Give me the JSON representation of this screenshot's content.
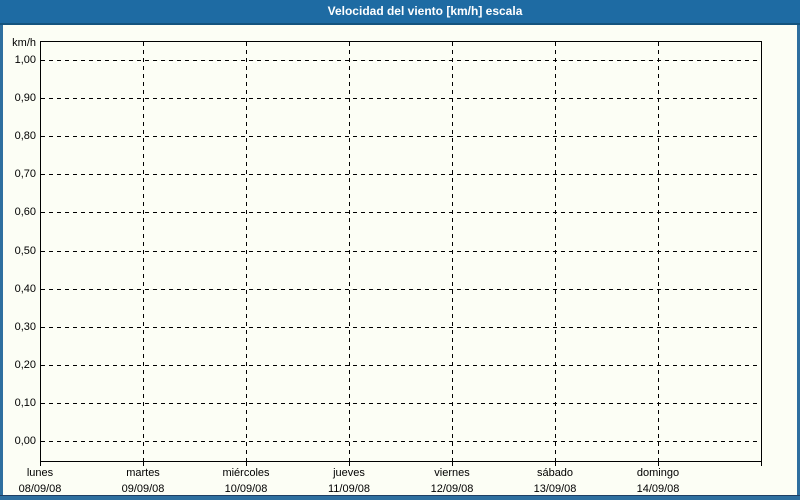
{
  "window": {
    "title": "Velocidad del viento [km/h] escala"
  },
  "y_axis": {
    "unit": "km/h",
    "ticks": [
      "1,00",
      "0,90",
      "0,80",
      "0,70",
      "0,60",
      "0,50",
      "0,40",
      "0,30",
      "0,20",
      "0,10",
      "0,00"
    ]
  },
  "x_axis": {
    "days": [
      {
        "day": "lunes",
        "date": "08/09/08"
      },
      {
        "day": "martes",
        "date": "09/09/08"
      },
      {
        "day": "miércoles",
        "date": "10/09/08"
      },
      {
        "day": "jueves",
        "date": "11/09/08"
      },
      {
        "day": "viernes",
        "date": "12/09/08"
      },
      {
        "day": "sábado",
        "date": "13/09/08"
      },
      {
        "day": "domingo",
        "date": "14/09/08"
      }
    ]
  },
  "chart_data": {
    "type": "line",
    "title": "Velocidad del viento [km/h] escala",
    "ylabel": "km/h",
    "ylim": [
      0.0,
      1.0
    ],
    "y_tick_step": 0.1,
    "y_tick_labels": [
      "0,00",
      "0,10",
      "0,20",
      "0,30",
      "0,40",
      "0,50",
      "0,60",
      "0,70",
      "0,80",
      "0,90",
      "1,00"
    ],
    "x_categories": [
      "lunes 08/09/08",
      "martes 09/09/08",
      "miércoles 10/09/08",
      "jueves 11/09/08",
      "viernes 12/09/08",
      "sábado 13/09/08",
      "domingo 14/09/08"
    ],
    "series": [],
    "grid": "dashed",
    "legend": "none"
  },
  "colors": {
    "titlebar": "#1e6ba3",
    "titlebar_edge": "#14547e",
    "window_border": "#2e6f9f",
    "background": "#fcfef5",
    "grid": "#000000",
    "title_text": "#ffffff"
  }
}
